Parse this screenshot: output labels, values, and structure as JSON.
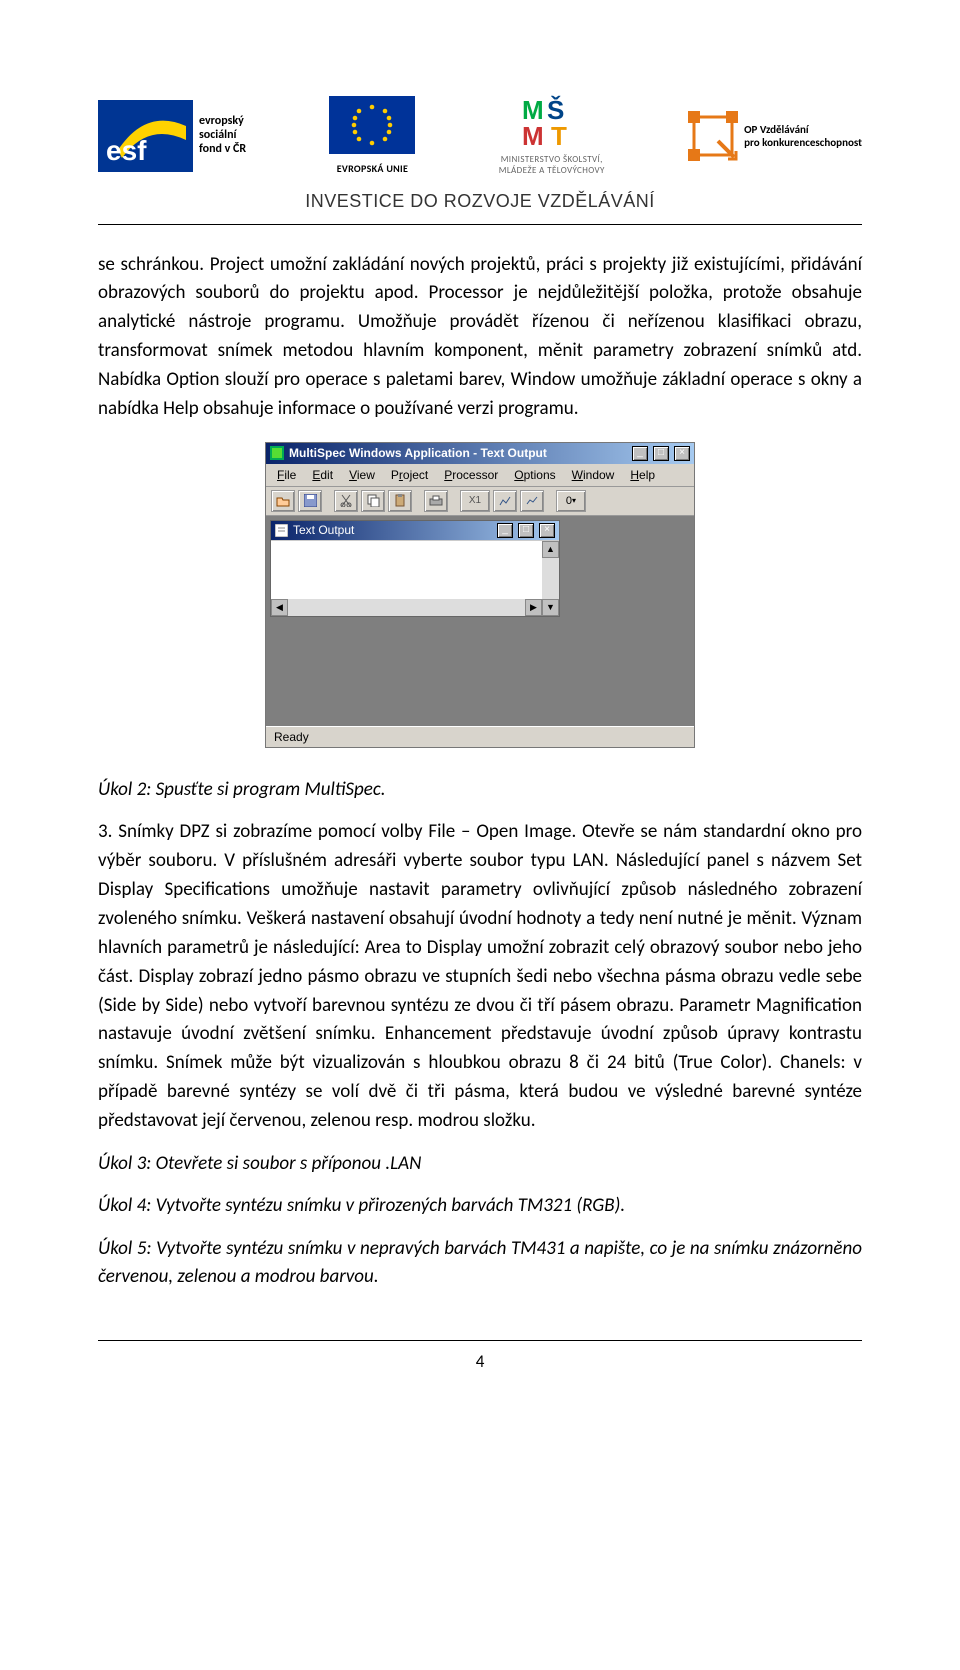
{
  "header": {
    "esf_label1": "evropský",
    "esf_label2": "sociální",
    "esf_label3": "fond v ČR",
    "eu_label": "EVROPSKÁ UNIE",
    "msmt_label1": "MINISTERSTVO ŠKOLSTVÍ,",
    "msmt_label2": "MLÁDEŽE A TĚLOVÝCHOVY",
    "op_label1": "OP Vzdělávání",
    "op_label2": "pro konkurenceschopnost",
    "investice": "INVESTICE DO ROZVOJE VZDĚLÁVÁNÍ"
  },
  "paragraphs": {
    "p1": "se schránkou. Project umožní zakládání nových projektů, práci s projekty již existujícími, přidávání obrazových souborů do projektu apod. Processor je nejdůležitější položka, protože obsahuje analytické nástroje programu. Umožňuje provádět řízenou či neřízenou klasifikaci obrazu, transformovat snímek metodou hlavním komponent, měnit parametry zobrazení snímků atd. Nabídka Option slouží pro operace s paletami barev, Window umožňuje základní operace s okny a nabídka Help obsahuje informace o používané verzi programu.",
    "p2": "3. Snímky DPZ si zobrazíme pomocí volby File – Open Image. Otevře se nám standardní okno pro výběr souboru. V příslušném adresáři vyberte soubor typu LAN. Následující panel s názvem Set Display Specifications umožňuje nastavit parametry ovlivňující způsob následného zobrazení zvoleného snímku. Veškerá nastavení obsahují úvodní hodnoty a tedy není nutné je měnit. Význam hlavních parametrů je následující: Area to Display umožní zobrazit celý obrazový soubor nebo jeho část. Display zobrazí jedno pásmo obrazu ve stupních šedi nebo všechna pásma obrazu vedle sebe (Side by Side) nebo vytvoří barevnou syntézu ze dvou či tří pásem obrazu. Parametr Magnification nastavuje úvodní zvětšení snímku. Enhancement představuje úvodní způsob úpravy kontrastu snímku. Snímek může být vizualizován s hloubkou obrazu 8 či 24 bitů (True Color). Chanels: v případě barevné syntézy se volí dvě či tři pásma, která budou ve výsledné barevné syntéze představovat její červenou, zelenou resp. modrou složku."
  },
  "tasks": {
    "t2": "Úkol 2: Spusťte si program MultiSpec.",
    "t3": "Úkol 3: Otevřete si soubor s příponou .LAN",
    "t4": "Úkol 4: Vytvořte syntézu snímku v přirozených barvách TM321 (RGB).",
    "t5": "Úkol 5: Vytvořte syntézu snímku v nepravých barvách TM431 a napište, co je na snímku znázorněno červenou, zelenou a modrou barvou."
  },
  "app": {
    "title": "MultiSpec Windows Application - Text Output",
    "menu": {
      "file": "File",
      "edit": "Edit",
      "view": "View",
      "project": "Project",
      "processor": "Processor",
      "options": "Options",
      "window": "Window",
      "help": "Help"
    },
    "toolbar_overlay": "0",
    "zoom_label": "X1",
    "sub_title": "Text Output",
    "status": "Ready"
  },
  "page_number": "4"
}
